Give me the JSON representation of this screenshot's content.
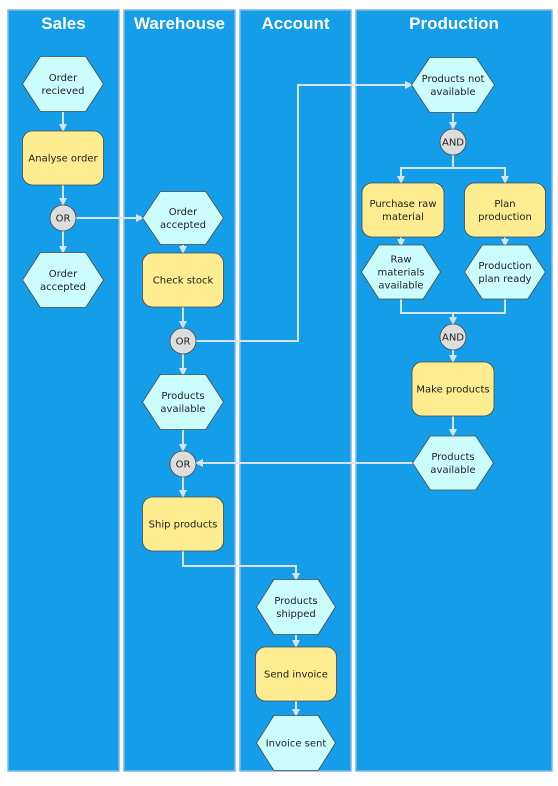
{
  "diagram": {
    "colors": {
      "lane_fill": "#149de8",
      "lane_border": "#7fb6e6",
      "event_fill": "#ccfdfd",
      "function_fill": "#fdec90",
      "connector_fill": "#dddddd",
      "arrow": "#d6e4f0",
      "outline": "#4a4a4a"
    },
    "lanes": [
      {
        "id": "sales",
        "title": "Sales"
      },
      {
        "id": "warehouse",
        "title": "Warehouse"
      },
      {
        "id": "account",
        "title": "Account"
      },
      {
        "id": "production",
        "title": "Production"
      }
    ],
    "nodes": [
      {
        "id": "order-recieved",
        "type": "event",
        "lines": [
          "Order",
          "recieved"
        ]
      },
      {
        "id": "analyse-order",
        "type": "function",
        "lines": [
          "Analyse order"
        ]
      },
      {
        "id": "or-sales",
        "type": "connector",
        "lines": [
          "OR"
        ]
      },
      {
        "id": "order-accepted-sales",
        "type": "event",
        "lines": [
          "Order",
          "accepted"
        ]
      },
      {
        "id": "order-accepted-warehouse",
        "type": "event",
        "lines": [
          "Order",
          "accepted"
        ]
      },
      {
        "id": "check-stock",
        "type": "function",
        "lines": [
          "Check stock"
        ]
      },
      {
        "id": "or-stock",
        "type": "connector",
        "lines": [
          "OR"
        ]
      },
      {
        "id": "products-available-warehouse",
        "type": "event",
        "lines": [
          "Products",
          "available"
        ]
      },
      {
        "id": "or-ship",
        "type": "connector",
        "lines": [
          "OR"
        ]
      },
      {
        "id": "ship-products",
        "type": "function",
        "lines": [
          "Ship products"
        ]
      },
      {
        "id": "products-shipped",
        "type": "event",
        "lines": [
          "Products",
          "shipped"
        ]
      },
      {
        "id": "send-invoice",
        "type": "function",
        "lines": [
          "Send invoice"
        ]
      },
      {
        "id": "invoice-sent",
        "type": "event",
        "lines": [
          "Invoice sent"
        ]
      },
      {
        "id": "products-not-available",
        "type": "event",
        "lines": [
          "Products not",
          "available"
        ]
      },
      {
        "id": "and-split",
        "type": "connector",
        "lines": [
          "AND"
        ]
      },
      {
        "id": "purchase-raw-material",
        "type": "function",
        "lines": [
          "Purchase raw",
          "material"
        ]
      },
      {
        "id": "plan-production",
        "type": "function",
        "lines": [
          "Plan",
          "production"
        ]
      },
      {
        "id": "raw-materials-available",
        "type": "event",
        "lines": [
          "Raw",
          "materials",
          "available"
        ]
      },
      {
        "id": "production-plan-ready",
        "type": "event",
        "lines": [
          "Production",
          "plan ready"
        ]
      },
      {
        "id": "and-join",
        "type": "connector",
        "lines": [
          "AND"
        ]
      },
      {
        "id": "make-products",
        "type": "function",
        "lines": [
          "Make products"
        ]
      },
      {
        "id": "products-available-production",
        "type": "event",
        "lines": [
          "Products",
          "available"
        ]
      }
    ],
    "edges": [
      [
        "order-recieved",
        "analyse-order"
      ],
      [
        "analyse-order",
        "or-sales"
      ],
      [
        "or-sales",
        "order-accepted-sales"
      ],
      [
        "or-sales",
        "order-accepted-warehouse"
      ],
      [
        "order-accepted-warehouse",
        "check-stock"
      ],
      [
        "check-stock",
        "or-stock"
      ],
      [
        "or-stock",
        "products-available-warehouse"
      ],
      [
        "or-stock",
        "products-not-available"
      ],
      [
        "products-available-warehouse",
        "or-ship"
      ],
      [
        "or-ship",
        "ship-products"
      ],
      [
        "ship-products",
        "products-shipped"
      ],
      [
        "products-shipped",
        "send-invoice"
      ],
      [
        "send-invoice",
        "invoice-sent"
      ],
      [
        "products-not-available",
        "and-split"
      ],
      [
        "and-split",
        "purchase-raw-material"
      ],
      [
        "and-split",
        "plan-production"
      ],
      [
        "purchase-raw-material",
        "raw-materials-available"
      ],
      [
        "plan-production",
        "production-plan-ready"
      ],
      [
        "raw-materials-available",
        "and-join"
      ],
      [
        "production-plan-ready",
        "and-join"
      ],
      [
        "and-join",
        "make-products"
      ],
      [
        "make-products",
        "products-available-production"
      ],
      [
        "products-available-production",
        "or-ship"
      ]
    ]
  }
}
